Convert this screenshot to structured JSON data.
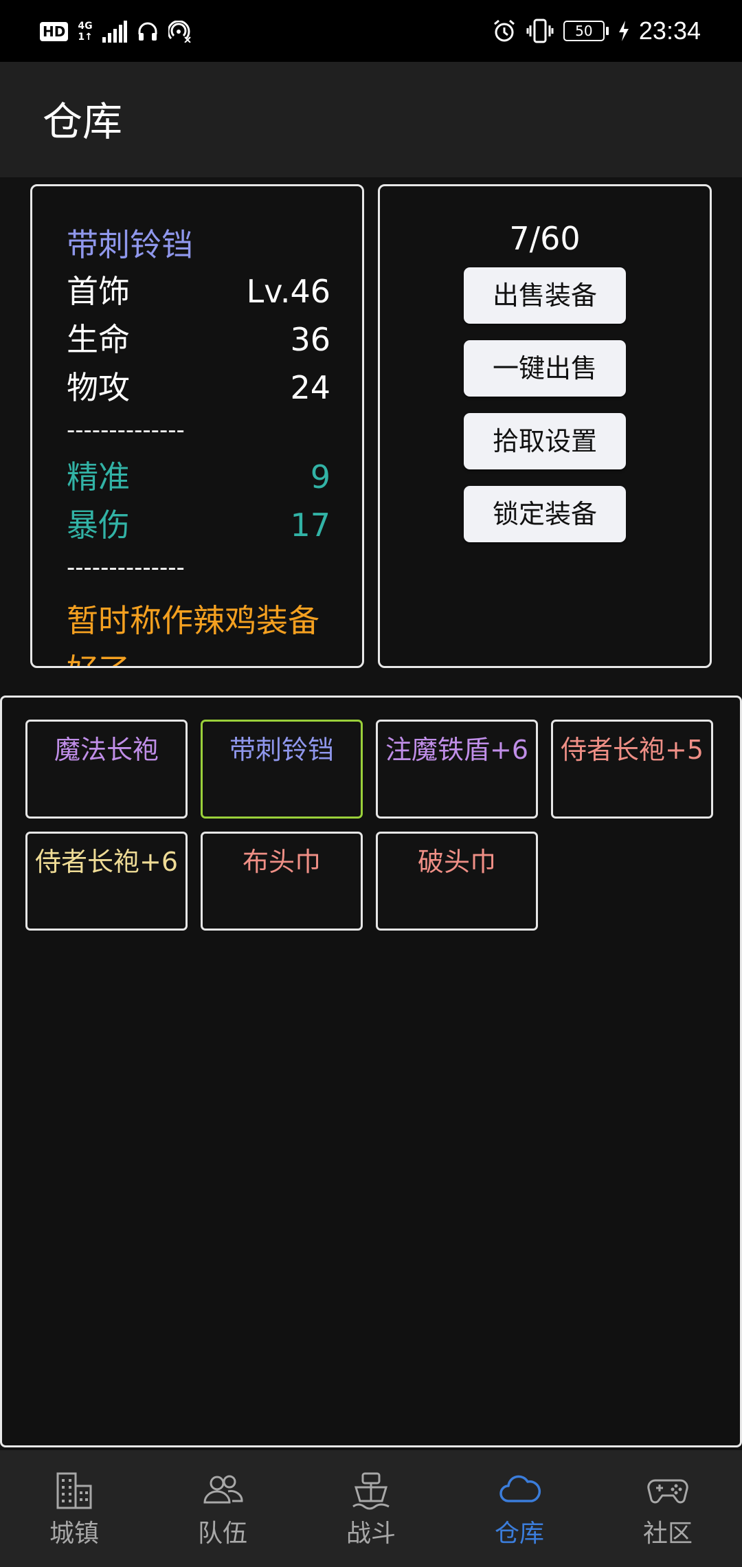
{
  "status_bar": {
    "hd_label": "HD",
    "network_label_top": "4G",
    "network_label_bottom": "1↑",
    "battery_level": "50",
    "time": "23:34",
    "icons": [
      "signal-icon",
      "headphones-icon",
      "hotspot-icon",
      "alarm-icon",
      "vibrate-icon",
      "battery-icon",
      "charging-icon"
    ]
  },
  "header": {
    "title": "仓库"
  },
  "detail": {
    "item_name": "带刺铃铛",
    "item_name_color": "#8f97ec",
    "stats": [
      {
        "label": "首饰",
        "value": "Lv.46"
      },
      {
        "label": "生命",
        "value": "36"
      },
      {
        "label": "物攻",
        "value": "24"
      }
    ],
    "separator": "--------------",
    "bonus_stats": [
      {
        "label": "精准",
        "value": "9"
      },
      {
        "label": "暴伤",
        "value": "17"
      }
    ],
    "bonus_color": "#32b3a6",
    "separator2": "--------------",
    "description": "暂时称作辣鸡装备好了",
    "description_color": "#f4a020"
  },
  "actions": {
    "capacity": "7/60",
    "buttons": [
      "出售装备",
      "一键出售",
      "拾取设置",
      "锁定装备"
    ]
  },
  "inventory": {
    "items": [
      {
        "name": "魔法长袍",
        "color": "#c08ee8",
        "selected": false
      },
      {
        "name": "带刺铃铛",
        "color": "#8f97ec",
        "selected": true
      },
      {
        "name": "注魔铁盾+6",
        "color": "#c08ee8",
        "selected": false
      },
      {
        "name": "侍者长袍+5",
        "color": "#ef8f86",
        "selected": false
      },
      {
        "name": "侍者长袍+6",
        "color": "#efdc96",
        "selected": false
      },
      {
        "name": "布头巾",
        "color": "#ef8f86",
        "selected": false
      },
      {
        "name": "破头巾",
        "color": "#ef8f86",
        "selected": false
      }
    ],
    "selected_border_color": "#9ad03a"
  },
  "bottom_nav": {
    "items": [
      {
        "label": "城镇",
        "icon": "buildings-icon",
        "active": false
      },
      {
        "label": "队伍",
        "icon": "team-icon",
        "active": false
      },
      {
        "label": "战斗",
        "icon": "ship-icon",
        "active": false
      },
      {
        "label": "仓库",
        "icon": "cloud-icon",
        "active": true
      },
      {
        "label": "社区",
        "icon": "gamepad-icon",
        "active": false
      }
    ],
    "active_color": "#3b7ddb",
    "inactive_color": "#a8a8a8"
  }
}
